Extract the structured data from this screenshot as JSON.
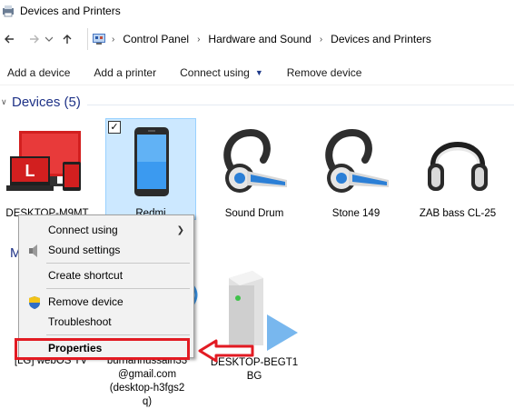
{
  "window": {
    "title": "Devices and Printers"
  },
  "address": {
    "crumbs": [
      "Control Panel",
      "Hardware and Sound",
      "Devices and Printers"
    ]
  },
  "commands": {
    "add_device": "Add a device",
    "add_printer": "Add a printer",
    "connect_using": "Connect using",
    "remove_device": "Remove device"
  },
  "devices_group": {
    "label": "Devices (5)"
  },
  "devices": [
    {
      "caption_line1": "DESKTOP-M9MT"
    },
    {
      "caption_line1": "Redmi"
    },
    {
      "caption_line1": "Sound Drum"
    },
    {
      "caption_line1": "Stone 149"
    },
    {
      "caption_line1": "ZAB bass CL-25"
    }
  ],
  "media_group": {
    "label_partial": "M"
  },
  "media_devices": [
    {
      "caption_line1": "[LG] webOS TV"
    },
    {
      "caption_line1": "burhanhussain33",
      "caption_line2": "@gmail.com",
      "caption_line3": "(desktop-h3fgs2",
      "caption_line4": "q)"
    },
    {
      "caption_line1": "DESKTOP-BEGT1",
      "caption_line2": "BG"
    }
  ],
  "context_menu": {
    "connect_using": "Connect using",
    "sound_settings": "Sound settings",
    "create_shortcut": "Create shortcut",
    "remove_device": "Remove device",
    "troubleshoot": "Troubleshoot",
    "properties": "Properties"
  },
  "colors": {
    "accent": "#1e3287",
    "selection": "#cce8ff",
    "highlight": "#e21b23"
  },
  "icons": [
    "devices-printers-icon",
    "back-arrow-icon",
    "forward-arrow-icon",
    "up-arrow-icon",
    "control-panel-icon",
    "computer-icon",
    "phone-icon",
    "headset-icon",
    "headphones-icon",
    "media-server-icon",
    "shield-icon",
    "speaker-icon"
  ]
}
